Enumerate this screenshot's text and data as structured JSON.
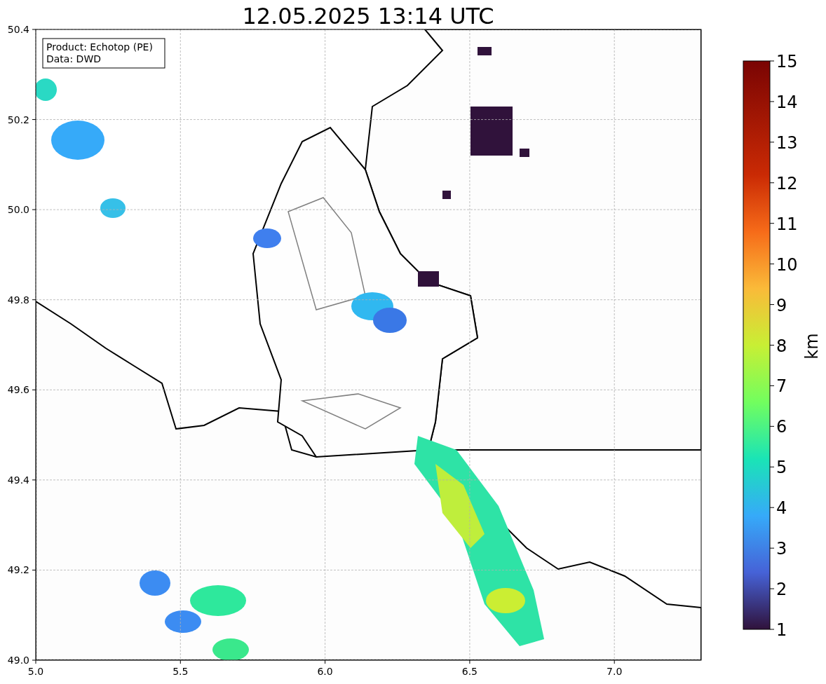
{
  "title": "12.05.2025 13:14 UTC",
  "legend": [
    "Product: Echotop (PE)",
    "Data: DWD"
  ],
  "x_ticks": [
    "5.0",
    "5.5",
    "6.0",
    "6.5",
    "7.0"
  ],
  "y_ticks": [
    "50.4",
    "50.2",
    "50.0",
    "49.8",
    "49.6",
    "49.4",
    "49.2",
    "49.0"
  ],
  "colorbar": {
    "label": "km",
    "ticks": [
      "15",
      "14",
      "13",
      "12",
      "11",
      "10",
      "9",
      "8",
      "7",
      "6",
      "5",
      "4",
      "3",
      "2",
      "1"
    ]
  }
}
